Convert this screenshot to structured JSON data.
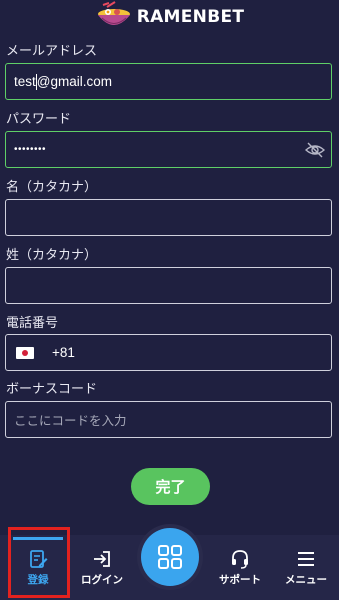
{
  "header": {
    "brand": "RAMENBET"
  },
  "form": {
    "email_label": "メールアドレス",
    "email_value_before_caret": "test",
    "email_value_after_caret": "@gmail.com",
    "password_label": "パスワード",
    "password_value": "••••••••",
    "first_name_label": "名（カタカナ）",
    "first_name_value": "",
    "last_name_label": "姓（カタカナ）",
    "last_name_value": "",
    "phone_label": "電話番号",
    "phone_dial_code": "+81",
    "bonus_label": "ボーナスコード",
    "bonus_placeholder": "ここにコードを入力",
    "submit_label": "完了"
  },
  "nav": {
    "register_label": "登録",
    "login_label": "ログイン",
    "support_label": "サポート",
    "menu_label": "メニュー"
  },
  "colors": {
    "background": "#1f2040",
    "active_border": "#5fcf67",
    "submit_bg": "#59c45f",
    "accent_blue": "#3aa5ee",
    "highlight_red": "#e3221f"
  },
  "icons": {
    "logo": "ramen-bowl-icon",
    "password_toggle": "eye-slash-icon",
    "country_flag": "japan-flag-icon",
    "register": "edit-document-icon",
    "login": "login-arrow-icon",
    "center": "grid-icon",
    "support": "headset-icon",
    "menu": "hamburger-icon"
  }
}
